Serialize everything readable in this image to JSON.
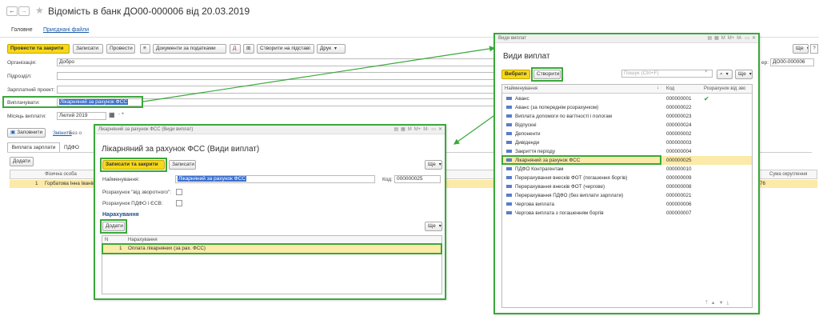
{
  "doc": {
    "title": "Відомість в банк ДО00-000006 від 20.03.2019",
    "tab_main": "Головне",
    "tab_files": "Приєднані файли",
    "btn_post_close": "Провести та закрити",
    "btn_save": "Записати",
    "btn_post": "Провести",
    "btn_docs_taxes": "Документи за податками",
    "btn_create_based": "Створити на підставі",
    "btn_print": "Друк",
    "btn_more": "Ще",
    "lbl_org": "Організація:",
    "val_org": "Добро",
    "lbl_dept": "Підрозділ:",
    "lbl_salary_project": "Зарплатний проект:",
    "lbl_pay": "Виплачувати:",
    "val_pay": "Лікарняний за рахунок ФСС",
    "lbl_month": "Місяць виплати:",
    "val_month": "Лютий 2019",
    "lbl_number": "ер:",
    "val_number": "ДО00-000006",
    "btn_fill": "Заповнити",
    "link_change": "Змінити",
    "txt_without": "Без о",
    "tabs": [
      "Виплата зарплати",
      "ПДФО"
    ],
    "btn_add": "Додати",
    "col_person": "Фізична особа",
    "row_num": "1",
    "row_person": "Горбатова Інна Іванів",
    "col_rounding": "Сума округлення",
    "row_right_value": "76"
  },
  "kinds": {
    "title_bar": "Види виплат",
    "title": "Види виплат",
    "btn_select": "Вибрати",
    "btn_create": "Створити",
    "search_placeholder": "Пошук (Ctrl+F)",
    "btn_more": "Ще",
    "col_name": "Найменування",
    "col_code": "Код",
    "col_calc": "Розрахунок від зво",
    "rows": [
      {
        "name": "Аванс",
        "code": "000000001",
        "check": "✔"
      },
      {
        "name": "Аванс (за попереднім розрахунком)",
        "code": "000000022",
        "check": ""
      },
      {
        "name": "Виплата допомоги по вагітності і пологам",
        "code": "000000023",
        "check": ""
      },
      {
        "name": "Відпускні",
        "code": "000000024",
        "check": ""
      },
      {
        "name": "Депоненти",
        "code": "000000002",
        "check": ""
      },
      {
        "name": "Дивіденди",
        "code": "000000003",
        "check": ""
      },
      {
        "name": "Закриття періоду",
        "code": "000000004",
        "check": ""
      },
      {
        "name": "Лікарняний за рахунок ФСС",
        "code": "000000025",
        "check": ""
      },
      {
        "name": "ПДФО Контрагентам",
        "code": "000000010",
        "check": ""
      },
      {
        "name": "Перерахування внесків ФОТ (погашення боргів)",
        "code": "000000009",
        "check": ""
      },
      {
        "name": "Перерахування внесків ФОТ (чергове)",
        "code": "000000008",
        "check": ""
      },
      {
        "name": "Перерахування ПДФО (без виплати зарплати)",
        "code": "000000021",
        "check": ""
      },
      {
        "name": "Чергова виплата",
        "code": "000000006",
        "check": ""
      },
      {
        "name": "Чергова виплата з погашенням боргів",
        "code": "000000007",
        "check": ""
      }
    ]
  },
  "item": {
    "title_bar": "Лікарняний за рахунок ФСС (Види виплат)",
    "title": "Лікарняний за рахунок ФСС (Види виплат)",
    "btn_save_close": "Записати та закрити",
    "btn_save": "Записати",
    "btn_more": "Ще",
    "lbl_name": "Найменування:",
    "val_name": "Лікарняний за рахунок ФСС",
    "lbl_code": "Код:",
    "val_code": "000000025",
    "lbl_calc_reverse": "Розрахунок \"від зворотного\":",
    "lbl_calc_taxes": "Розрахунок ПДФО і ЄСВ:",
    "section": "Нарахування",
    "btn_add": "Додати",
    "btn_more2": "Ще",
    "col_n": "N",
    "col_accrual": "Нарахування",
    "row_n": "1",
    "row_accrual": "Оплата лікарняних (за рах. ФСС)"
  },
  "colors": {
    "accent": "#f6d81a",
    "highlight": "#3aa83a",
    "selection": "#fbeaa8"
  }
}
